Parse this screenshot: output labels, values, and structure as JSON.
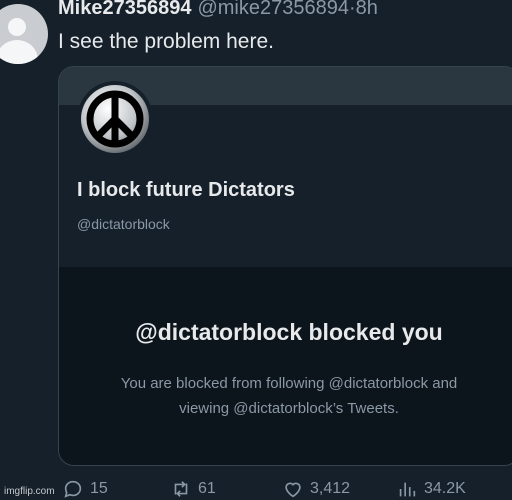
{
  "tweet": {
    "display_name": "Mike27356894",
    "handle": "@mike27356894",
    "separator": "·",
    "time": "8h",
    "text": "I see the problem here."
  },
  "card": {
    "profile_name": "I block future Dictators",
    "profile_handle": "@dictatorblock",
    "avatar_icon": "peace-sign-icon",
    "blocked_title": "@dictatorblock blocked you",
    "blocked_line1": "You are blocked from following @dictatorblock and",
    "blocked_line2": "viewing @dictatorblock’s Tweets."
  },
  "actions": {
    "replies": "15",
    "retweets": "61",
    "likes": "3,412",
    "views": "34.2K"
  },
  "watermark": "imgflip.com",
  "colors": {
    "background": "#15202b",
    "blocked_panel": "#0c141c",
    "text_primary": "#e7e9ea",
    "text_secondary": "#8b98a5"
  }
}
